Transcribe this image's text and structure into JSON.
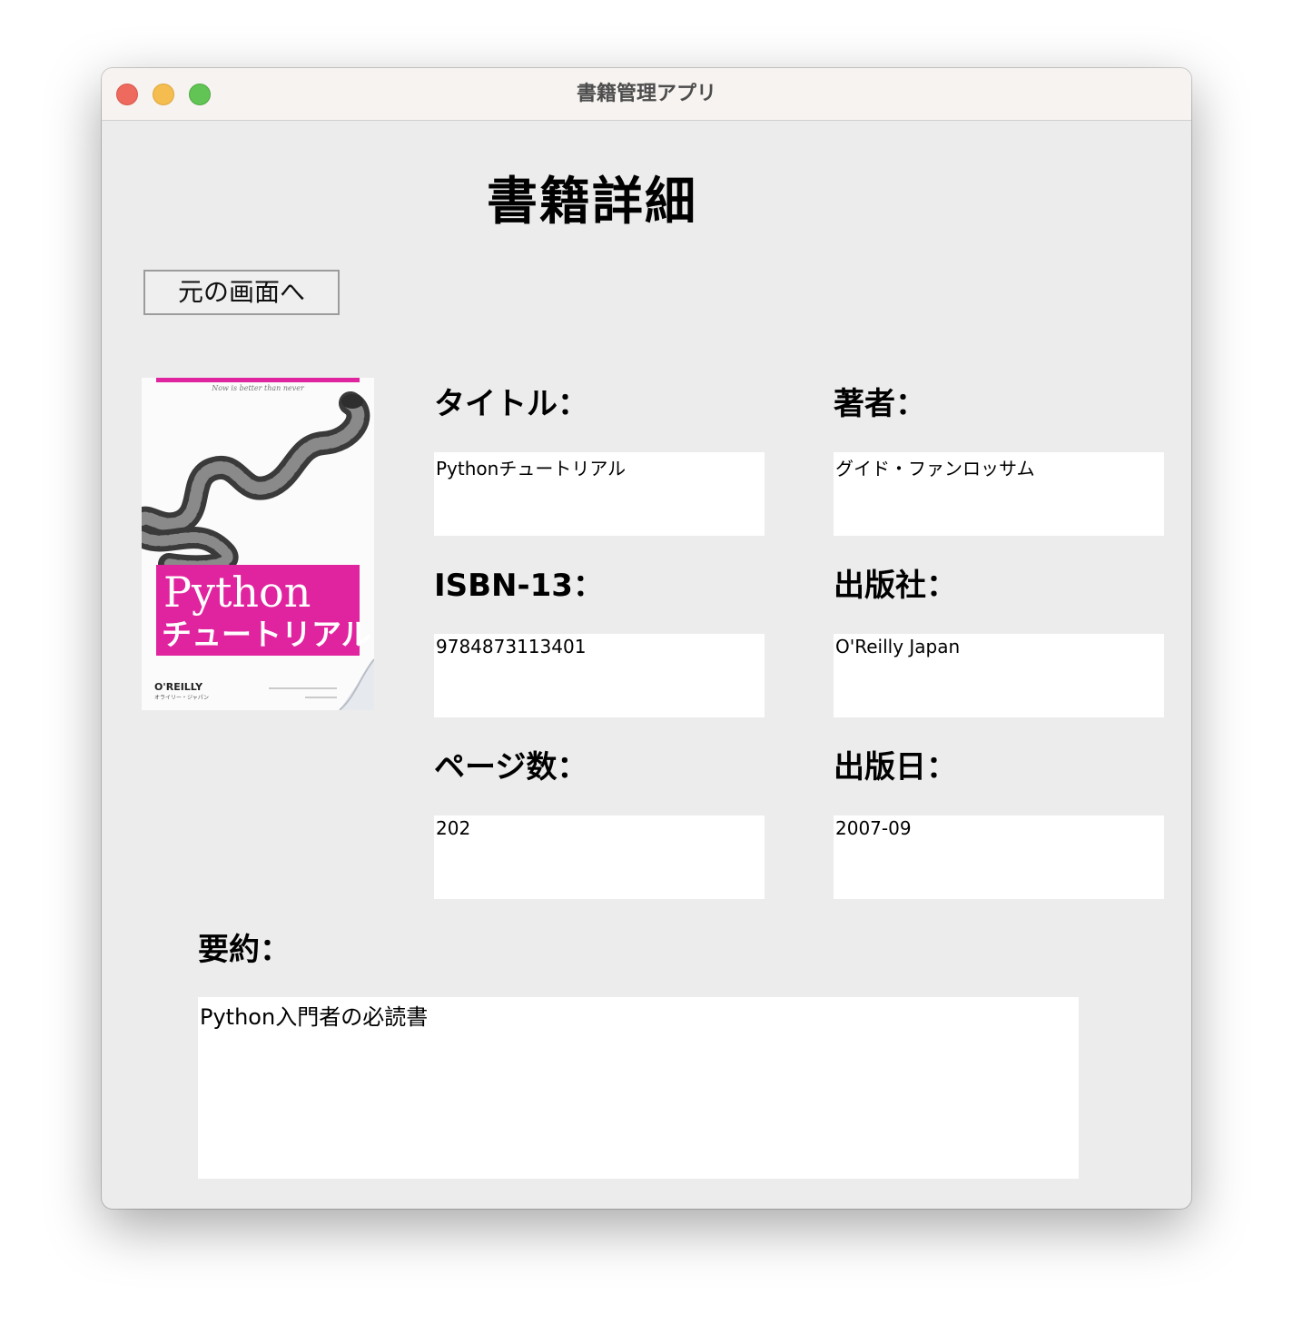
{
  "window": {
    "title": "書籍管理アプリ"
  },
  "page": {
    "heading": "書籍詳細",
    "back_button_label": "元の画面へ"
  },
  "cover": {
    "series_line": "Now is better than never",
    "title_en": "Python",
    "title_ja": "チュートリアル",
    "publisher_logo": "O'REILLY",
    "publisher_ja": "オライリー・ジャパン",
    "accent_color": "#e0239e"
  },
  "fields": {
    "title": {
      "label": "タイトル：",
      "value": "Pythonチュートリアル"
    },
    "author": {
      "label": "著者：",
      "value": "グイド・ファンロッサム"
    },
    "isbn": {
      "label": "ISBN-13：",
      "value": "9784873113401"
    },
    "publisher": {
      "label": "出版社：",
      "value": "O'Reilly Japan"
    },
    "pages": {
      "label": "ページ数：",
      "value": "202"
    },
    "pubdate": {
      "label": "出版日：",
      "value": "2007-09"
    },
    "summary": {
      "label": "要約：",
      "value": "Python入門者の必読書"
    }
  },
  "icons": {
    "close": "traffic-close-icon",
    "minimize": "traffic-minimize-icon",
    "maximize": "traffic-maximize-icon"
  }
}
